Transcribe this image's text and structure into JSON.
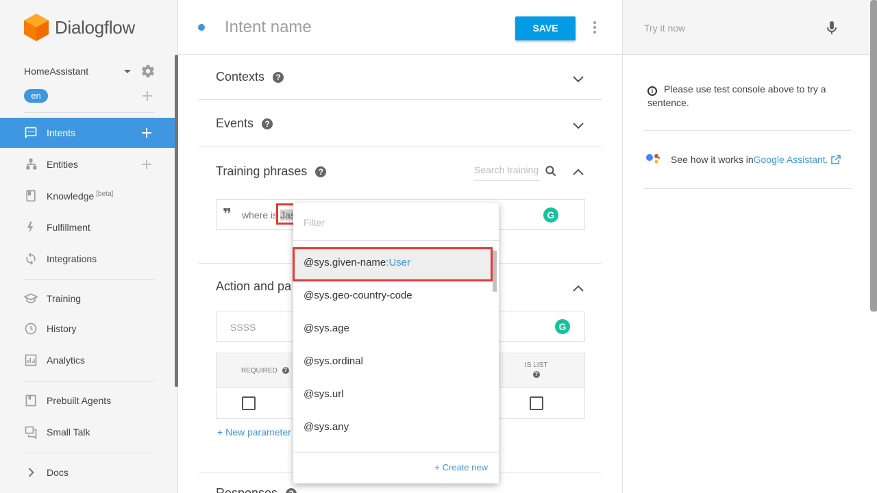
{
  "app": {
    "brand": "Dialogflow"
  },
  "sidebar": {
    "agent": "HomeAssistant",
    "language": "en",
    "items": [
      {
        "label": "Intents",
        "active": true
      },
      {
        "label": "Entities"
      },
      {
        "label": "Knowledge",
        "badge": "[beta]"
      },
      {
        "label": "Fulfillment"
      },
      {
        "label": "Integrations"
      },
      {
        "label": "Training"
      },
      {
        "label": "History"
      },
      {
        "label": "Analytics"
      },
      {
        "label": "Prebuilt Agents"
      },
      {
        "label": "Small Talk"
      },
      {
        "label": "Docs"
      }
    ]
  },
  "header": {
    "intent_placeholder": "Intent name",
    "save_label": "SAVE"
  },
  "sections": {
    "contexts": "Contexts",
    "events": "Events",
    "training": "Training phrases",
    "search_placeholder": "Search training",
    "action": "Action and pa",
    "responses": "Responses"
  },
  "training": {
    "phrase_prefix": "where is ",
    "phrase_highlight": "Jas"
  },
  "action": {
    "value": "SSSS",
    "col_required": "REQUIRED",
    "col_is_list": "IS LIST",
    "new_parameter": "New parameter"
  },
  "dropdown": {
    "filter_placeholder": "Filter",
    "items": [
      {
        "entity": "@sys.given-name",
        "alias": ":User"
      },
      {
        "entity": "@sys.geo-country-code",
        "alias": ""
      },
      {
        "entity": "@sys.age",
        "alias": ""
      },
      {
        "entity": "@sys.ordinal",
        "alias": ""
      },
      {
        "entity": "@sys.url",
        "alias": ""
      },
      {
        "entity": "@sys.any",
        "alias": ""
      }
    ],
    "create_new": "Create new"
  },
  "test_panel": {
    "try_placeholder": "Try it now",
    "info": "Please use test console above to try a sentence.",
    "ga_text": "See how it works in ",
    "ga_link": "Google Assistant."
  },
  "colors": {
    "accent": "#3e97e0",
    "save": "#039be5",
    "highlight_box": "#e53935",
    "grammarly": "#15c39a"
  }
}
